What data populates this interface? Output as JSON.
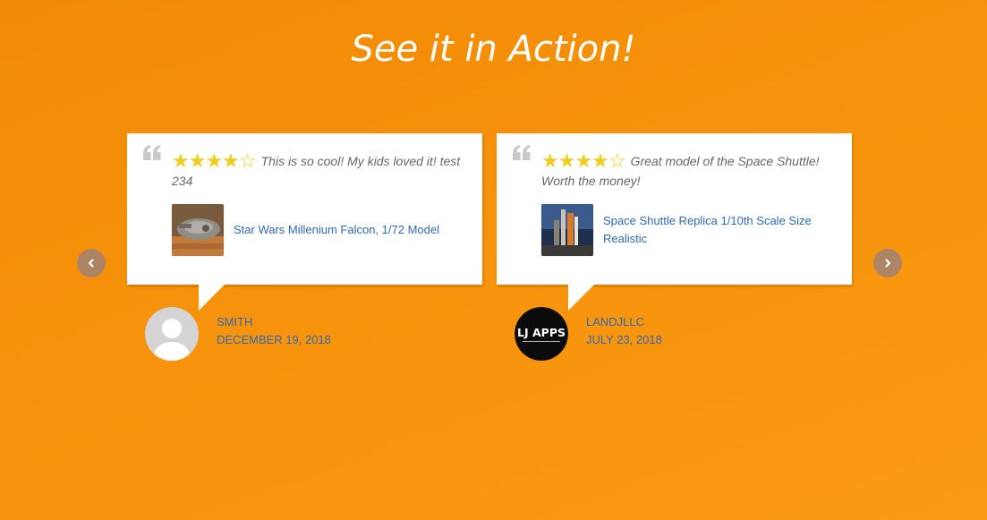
{
  "section": {
    "title": "See it in Action!"
  },
  "carousel": {
    "prev_icon": "chevron-left-icon",
    "next_icon": "chevron-right-icon"
  },
  "colors": {
    "background": "#f7930c",
    "star": "#f0cc1d",
    "link": "#2e69b3",
    "quote": "#c8c8c8"
  },
  "reviews": [
    {
      "rating": 4,
      "max_rating": 5,
      "stars_display": "★★★★☆",
      "text": "This is so cool! My kids loved it! test 234",
      "product_name": "Star Wars Millenium Falcon, 1/72 Model",
      "reviewer_name": "SMITH",
      "date": "DECEMBER 19, 2018"
    },
    {
      "rating": 4,
      "max_rating": 5,
      "stars_display": "★★★★☆",
      "text": "Great model of the Space Shuttle! Worth the money!",
      "product_name": "Space Shuttle Replica 1/10th Scale Size Realistic",
      "reviewer_name": "LANDJLLC",
      "date": "JULY 23, 2018",
      "avatar_logo_text": "LJ APPS"
    }
  ]
}
